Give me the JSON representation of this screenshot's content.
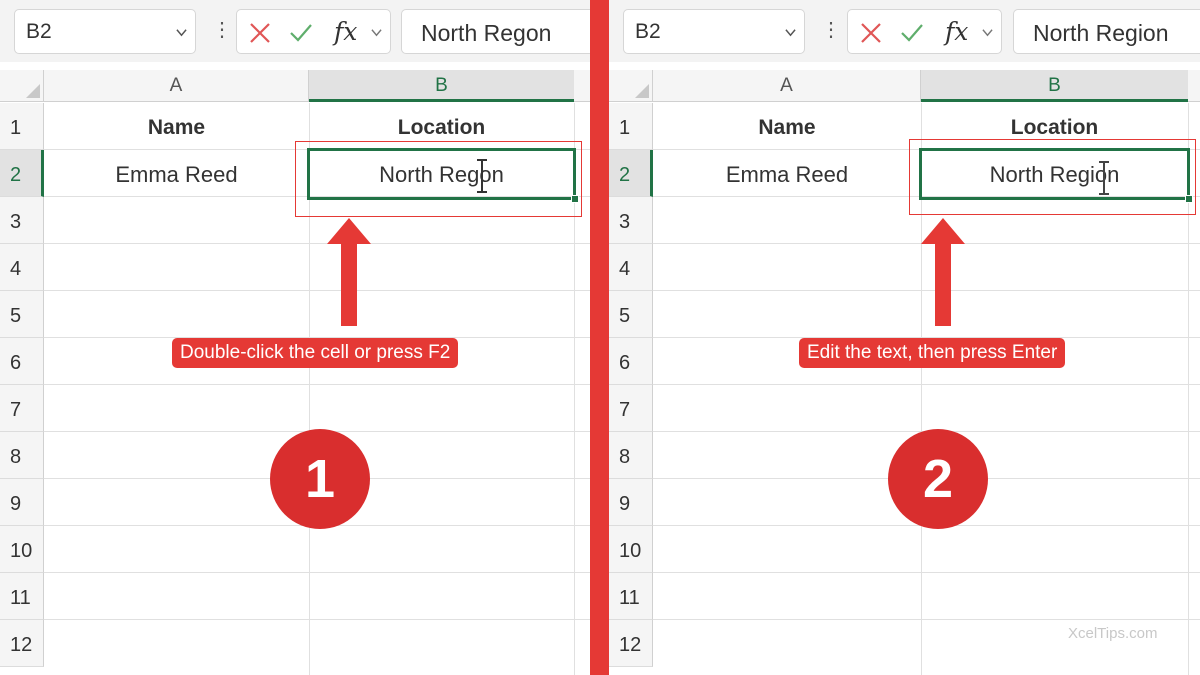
{
  "colors": {
    "excel_green": "#217346",
    "accent_red": "#e53935"
  },
  "panels": [
    {
      "name_box": "B2",
      "formula_value": "North Regon",
      "columns": [
        "A",
        "B"
      ],
      "rows": [
        "1",
        "2",
        "3",
        "4",
        "5",
        "6",
        "7",
        "8",
        "9",
        "10",
        "11",
        "12"
      ],
      "cells": {
        "a1": "Name",
        "b1": "Location",
        "a2": "Emma Reed",
        "b2": "North Regon"
      },
      "instruction": "Double-click the cell or press F2",
      "step": "1"
    },
    {
      "name_box": "B2",
      "formula_value": "North Region",
      "columns": [
        "A",
        "B"
      ],
      "rows": [
        "1",
        "2",
        "3",
        "4",
        "5",
        "6",
        "7",
        "8",
        "9",
        "10",
        "11",
        "12"
      ],
      "cells": {
        "a1": "Name",
        "b1": "Location",
        "a2": "Emma Reed",
        "b2": "North Region"
      },
      "instruction": "Edit the text, then press Enter",
      "step": "2"
    }
  ],
  "icons": {
    "cancel": "x-icon",
    "enter": "check-icon",
    "function": "fx-icon",
    "dropdown": "chevron-down-icon",
    "more": "vertical-ellipsis-icon"
  },
  "watermark": "XcelTips.com"
}
